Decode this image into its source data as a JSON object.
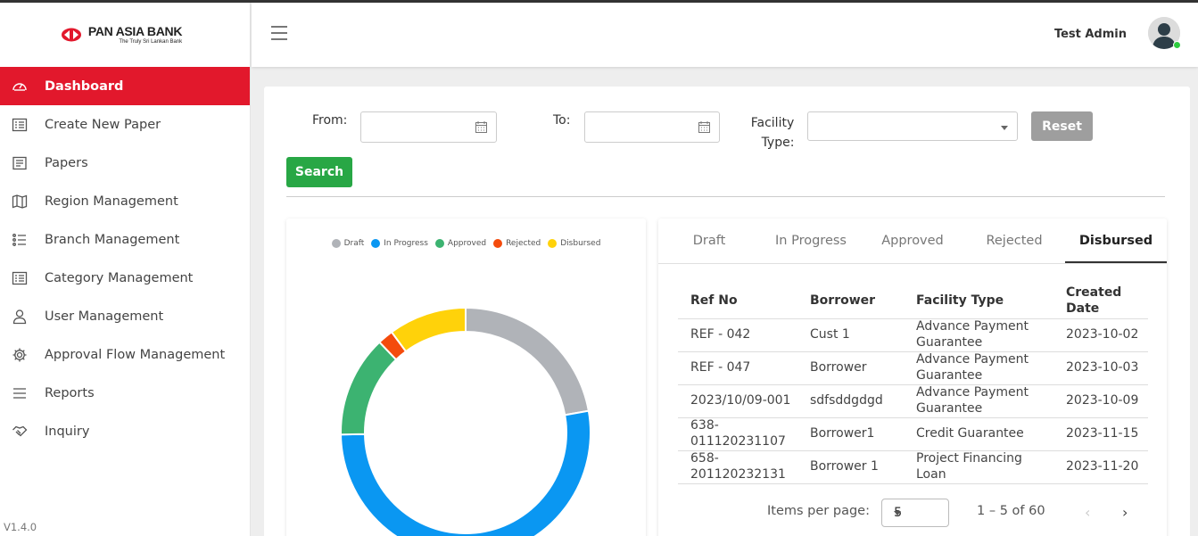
{
  "brand": {
    "name": "PAN ASIA BANK",
    "tagline": "The Truly Sri Lankan Bank"
  },
  "version": "V1.4.0",
  "sidebar": {
    "items": [
      {
        "label": "Dashboard",
        "icon": "gauge-icon",
        "active": true
      },
      {
        "label": "Create New Paper",
        "icon": "form-icon"
      },
      {
        "label": "Papers",
        "icon": "document-icon"
      },
      {
        "label": "Region Management",
        "icon": "map-icon"
      },
      {
        "label": "Branch Management",
        "icon": "list-icon"
      },
      {
        "label": "Category Management",
        "icon": "grid-icon"
      },
      {
        "label": "User Management",
        "icon": "user-icon"
      },
      {
        "label": "Approval Flow Management",
        "icon": "gear-icon"
      },
      {
        "label": "Reports",
        "icon": "menu-icon"
      },
      {
        "label": "Inquiry",
        "icon": "handshake-icon"
      }
    ]
  },
  "header": {
    "user_name": "Test Admin"
  },
  "filters": {
    "from_label": "From:",
    "to_label": "To:",
    "facility_label_1": "Facility",
    "facility_label_2": "Type:",
    "reset_label": "Reset",
    "search_label": "Search"
  },
  "colors": {
    "accent": "#e2182c",
    "search": "#28a745",
    "reset": "#9e9e9e"
  },
  "chart_data": {
    "type": "pie",
    "categories": [
      "Draft",
      "In Progress",
      "Approved",
      "Rejected",
      "Disbursed"
    ],
    "values": [
      22,
      52,
      13,
      2,
      10
    ],
    "colors": [
      "#b0b3b8",
      "#0a97f2",
      "#3cb371",
      "#f44b0c",
      "#ffd20a"
    ],
    "legend_position": "top"
  },
  "tabs": [
    {
      "label": "Draft"
    },
    {
      "label": "In Progress"
    },
    {
      "label": "Approved"
    },
    {
      "label": "Rejected"
    },
    {
      "label": "Disbursed",
      "active": true
    }
  ],
  "table": {
    "headers": [
      "Ref No",
      "Borrower",
      "Facility Type",
      "Created Date"
    ],
    "rows": [
      [
        "REF - 042",
        "Cust 1",
        "Advance Payment Guarantee",
        "2023-10-02"
      ],
      [
        "REF - 047",
        "Borrower",
        "Advance Payment Guarantee",
        "2023-10-03"
      ],
      [
        "2023/10/09-001",
        "sdfsddgdgd",
        "Advance Payment Guarantee",
        "2023-10-09"
      ],
      [
        "638-011120231107",
        "Borrower1",
        "Credit Guarantee",
        "2023-11-15"
      ],
      [
        "658-201120232131",
        "Borrower 1",
        "Project Financing Loan",
        "2023-11-20"
      ]
    ]
  },
  "paginator": {
    "label": "Items per page:",
    "page_size": "5",
    "range": "1 – 5 of 60"
  }
}
